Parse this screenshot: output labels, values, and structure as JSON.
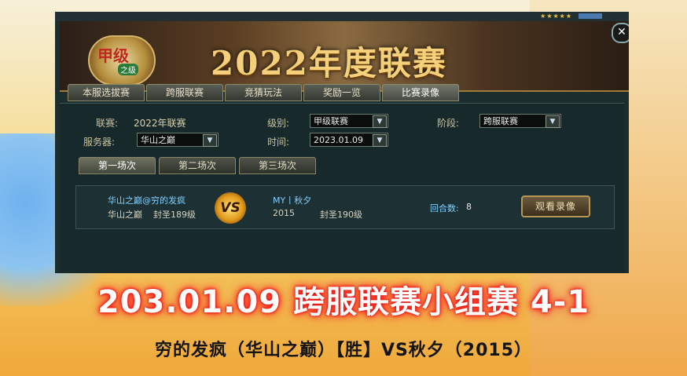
{
  "banner": {
    "emblem_text": "甲级",
    "emblem_sub": "之级",
    "title": "2022年度联赛"
  },
  "top_tabs": [
    "本服选拔赛",
    "跨服联赛",
    "竞猜玩法",
    "奖励一览",
    "比赛录像"
  ],
  "filters": {
    "league_label": "联赛:",
    "league_value": "2022年联赛",
    "level_label": "级别:",
    "level_value": "甲级联赛",
    "stage_label": "阶段:",
    "stage_value": "跨服联赛",
    "server_label": "服务器:",
    "server_value": "华山之巅",
    "time_label": "时间:",
    "time_value": "2023.01.09"
  },
  "round_tabs": [
    "第一场次",
    "第二场次",
    "第三场次"
  ],
  "match": {
    "player1_name": "华山之巅@穷的发疯",
    "player1_server": "华山之巅",
    "player1_level": "封圣189级",
    "vs_text": "VS",
    "player2_name": "MY丨秋夕",
    "player2_server": "2015",
    "player2_level": "封圣190级",
    "rounds_label": "回合数:",
    "rounds_value": "8",
    "watch_button": "观看录像"
  },
  "caption": {
    "title": "203.01.09 跨服联赛小组赛 4-1",
    "subtitle": "穷的发疯（华山之巅）【胜】VS秋夕（2015）"
  },
  "colors": {
    "caption_glow": "#e01010",
    "player_name": "#7fd0ff",
    "banner_title": "#f3d079"
  }
}
